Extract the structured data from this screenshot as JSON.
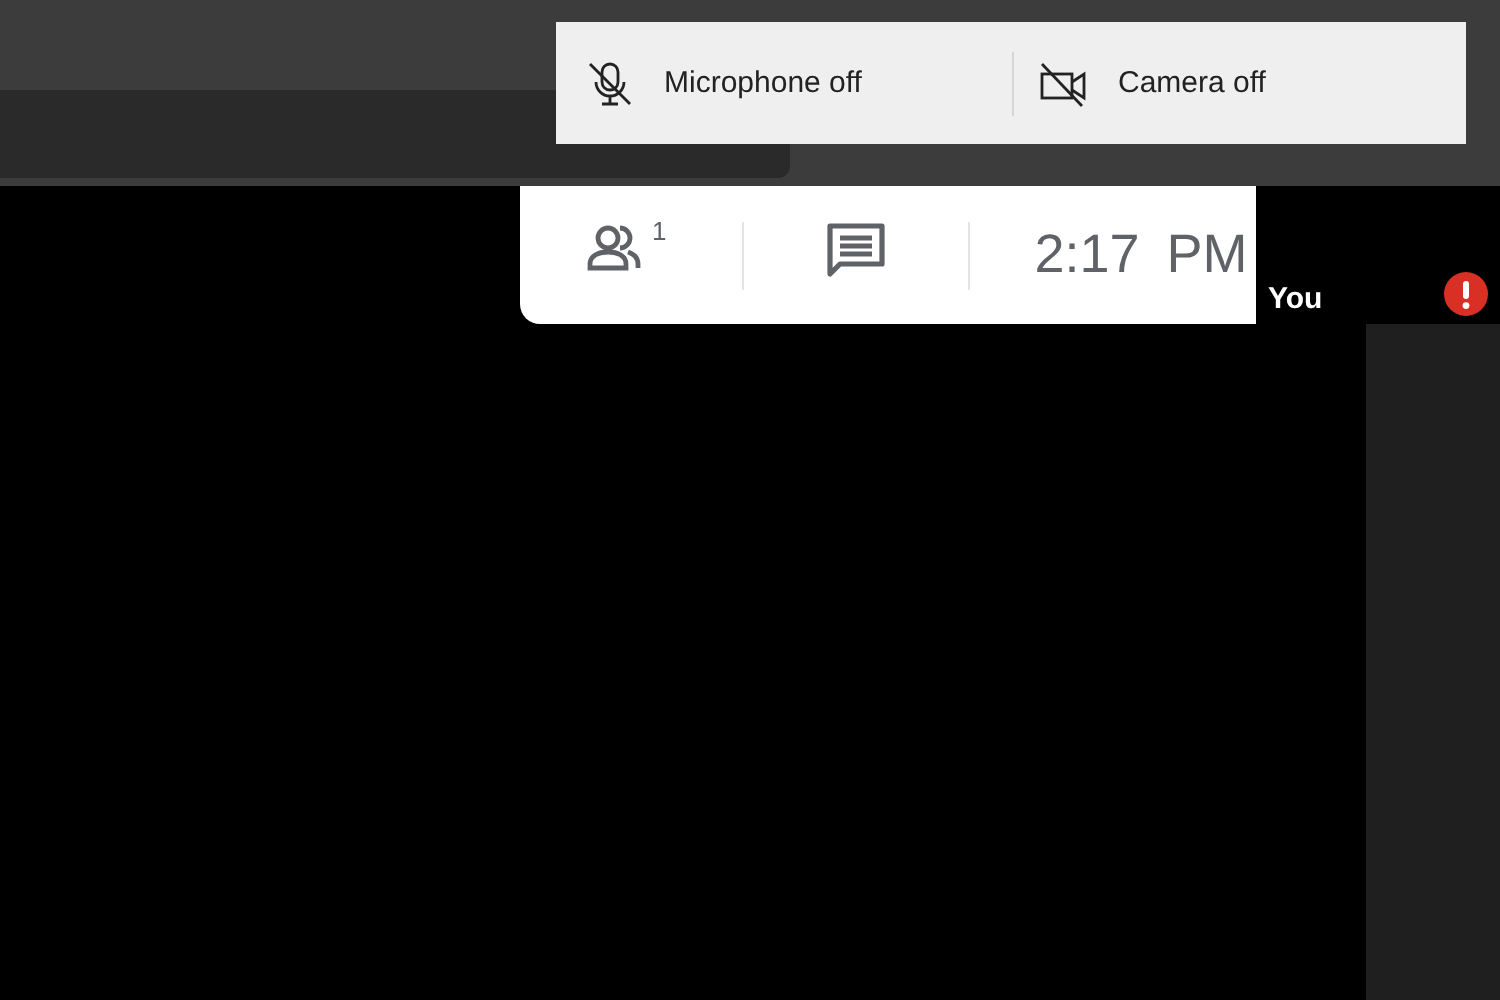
{
  "popup": {
    "items": [
      {
        "kind": "microphone",
        "label": "Microphone off",
        "on": false
      },
      {
        "kind": "camera",
        "label": "Camera off",
        "on": false
      }
    ]
  },
  "call_bar": {
    "participants_count": "1",
    "time": "2:17 PM"
  },
  "self_tile": {
    "name": "You",
    "alert": true
  }
}
